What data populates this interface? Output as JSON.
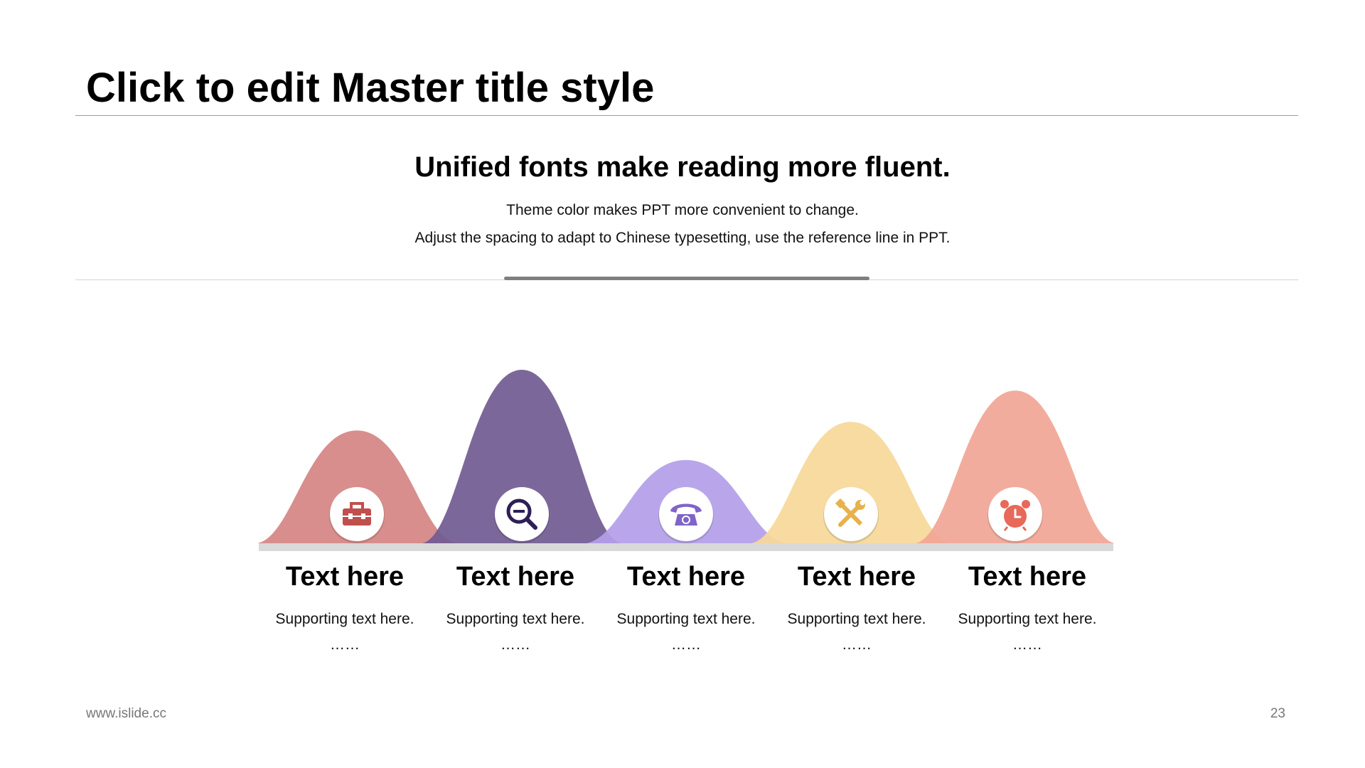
{
  "title": "Click to edit Master title style",
  "subtitle": "Unified fonts make reading more fluent.",
  "description": [
    "Theme color makes PPT more convenient to change.",
    "Adjust the spacing to adapt to Chinese typesetting, use the reference line in PPT."
  ],
  "items": [
    {
      "title": "Text here",
      "sub": "Supporting text here.",
      "dots": "……",
      "color": "#d48584",
      "icon": "toolbox-icon",
      "icon_color": "#c0504d",
      "level": 0.65
    },
    {
      "title": "Text here",
      "sub": "Supporting text here.",
      "dots": "……",
      "color": "#725b92",
      "icon": "zoom-out-icon",
      "icon_color": "#2e1f57",
      "level": 1.0
    },
    {
      "title": "Text here",
      "sub": "Supporting text here.",
      "dots": "……",
      "color": "#b49fe8",
      "icon": "telephone-icon",
      "icon_color": "#8064c8",
      "level": 0.48
    },
    {
      "title": "Text here",
      "sub": "Supporting text here.",
      "dots": "……",
      "color": "#f6d89a",
      "icon": "tools-icon",
      "icon_color": "#e8b14a",
      "level": 0.7
    },
    {
      "title": "Text here",
      "sub": "Supporting text here.",
      "dots": "……",
      "color": "#f1a696",
      "icon": "alarm-clock-icon",
      "icon_color": "#e8685a",
      "level": 0.88
    }
  ],
  "footer": {
    "url": "www.islide.cc",
    "page": "23"
  }
}
